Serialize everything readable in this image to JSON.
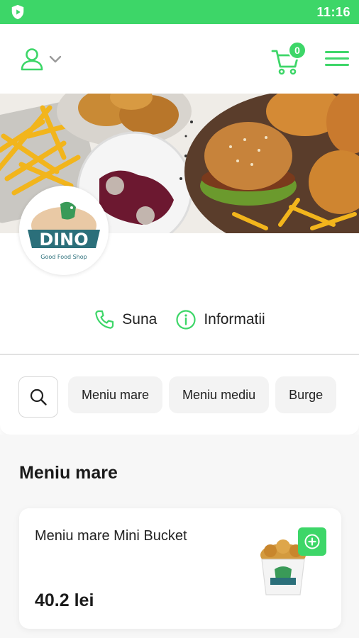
{
  "status_bar": {
    "time": "11:16",
    "app_icon": "shield-play-icon"
  },
  "header": {
    "user_icon": "user-icon",
    "dropdown_icon": "chevron-down-icon",
    "cart_icon": "cart-icon",
    "cart_count": "0",
    "menu_icon": "hamburger-menu-icon"
  },
  "restaurant": {
    "logo_name": "DINO",
    "logo_tagline": "Good Food Shop"
  },
  "actions": {
    "call_label": "Suna",
    "info_label": "Informatii"
  },
  "categories": {
    "search_icon": "search-icon",
    "items": [
      "Meniu mare",
      "Meniu mediu",
      "Burge"
    ]
  },
  "section": {
    "title": "Meniu mare",
    "products": [
      {
        "name": "Meniu mare Mini Bucket",
        "price": "40.2 lei"
      }
    ]
  },
  "colors": {
    "accent": "#3dd668",
    "chip_background": "#f3f3f3",
    "section_background": "#f7f7f7"
  }
}
